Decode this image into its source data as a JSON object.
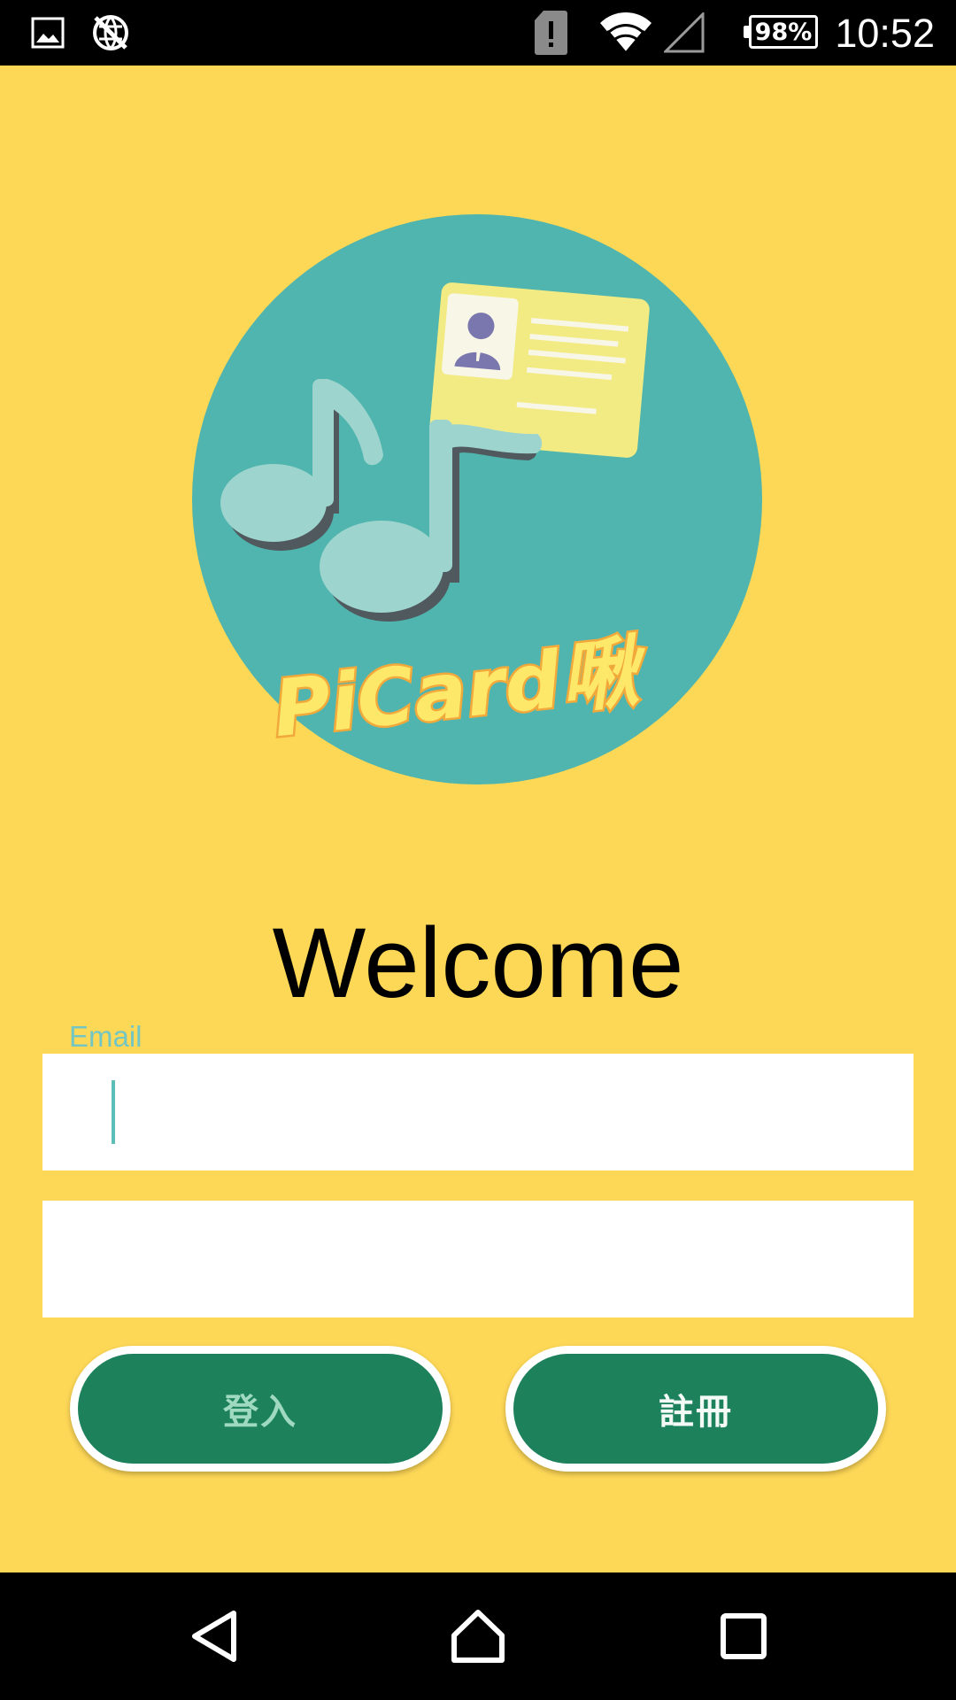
{
  "status_bar": {
    "icons": [
      "gallery-icon",
      "no-sync-icon",
      "sim-alert-icon",
      "wifi-icon",
      "cell-signal-icon"
    ],
    "battery": "98%",
    "time": "10:52"
  },
  "logo": {
    "brand_text": "PiCard啾",
    "colors": {
      "circle": "#4FB5AE",
      "note": "#9DD4CE",
      "card": "#F2EB84",
      "text": "#FDE86A",
      "text_outline": "#F2A93B"
    }
  },
  "main": {
    "welcome": "Welcome",
    "email_label": "Email",
    "email_value": "",
    "password_value": "",
    "login_label": "登入",
    "register_label": "註冊"
  },
  "nav_bar": {
    "icons": [
      "back-icon",
      "home-icon",
      "recents-icon"
    ]
  },
  "colors": {
    "background": "#FDD756",
    "button": "#1D825C",
    "label": "#73C6C2"
  }
}
